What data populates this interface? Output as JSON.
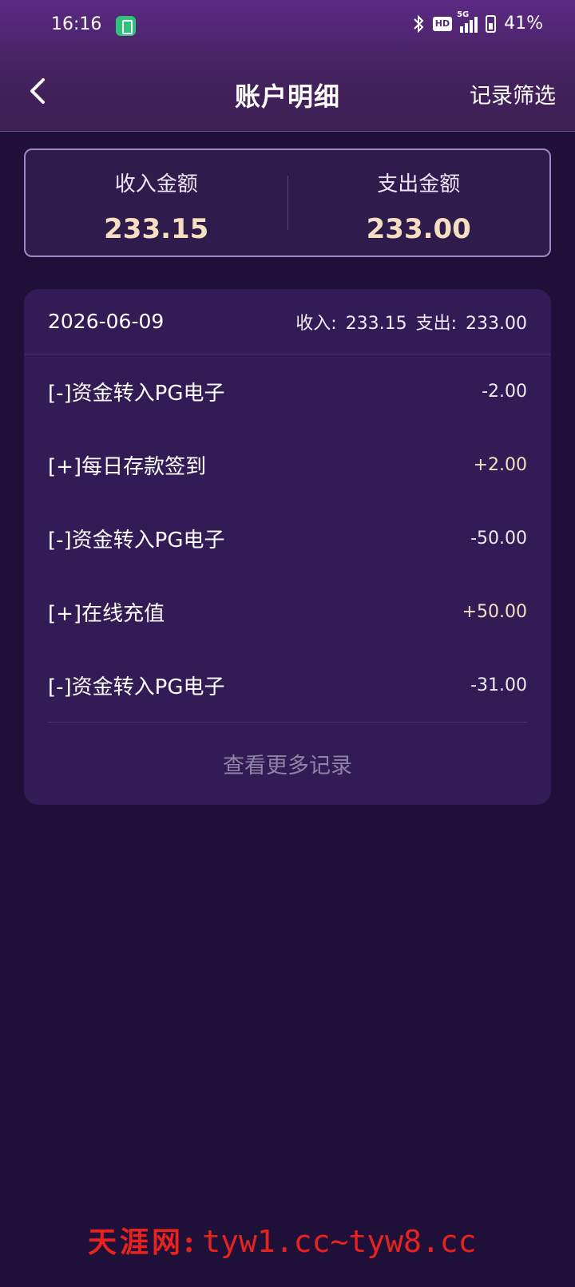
{
  "status_bar": {
    "time": "16:16",
    "hd": "HD",
    "network": "5G",
    "battery": "41%"
  },
  "header": {
    "title": "账户明细",
    "filter_label": "记录筛选"
  },
  "summary": {
    "income_label": "收入金额",
    "income_value": "233.15",
    "expense_label": "支出金额",
    "expense_value": "233.00"
  },
  "day": {
    "date": "2026-06-09",
    "income_label": "收入:",
    "income_value": "233.15",
    "expense_label": "支出:",
    "expense_value": "233.00"
  },
  "records": [
    {
      "title": "[-]资金转入PG电子",
      "amount": "-2.00",
      "type": "minus"
    },
    {
      "title": "[+]每日存款签到",
      "amount": "+2.00",
      "type": "plus"
    },
    {
      "title": "[-]资金转入PG电子",
      "amount": "-50.00",
      "type": "minus"
    },
    {
      "title": "[+]在线充值",
      "amount": "+50.00",
      "type": "plus"
    },
    {
      "title": "[-]资金转入PG电子",
      "amount": "-31.00",
      "type": "minus"
    }
  ],
  "more_label": "查看更多记录",
  "watermark": {
    "text_cn": "天涯网:",
    "text_url": "tyw1.cc~tyw8.cc"
  },
  "colors": {
    "background": "#1e1039",
    "header": "#5b2a84",
    "card": "#331c55",
    "amount_highlight": "#f5dfc1",
    "watermark": "#e8231d"
  }
}
